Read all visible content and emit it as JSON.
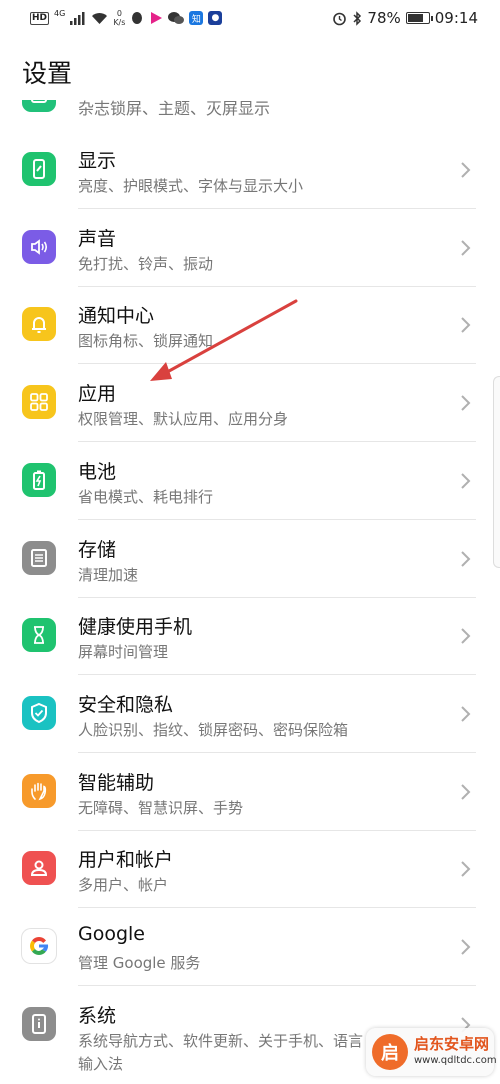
{
  "status_bar": {
    "network_badge": "HD",
    "network_type": "4G",
    "speed_value": "0",
    "speed_unit": "K/s",
    "zhihu_label": "知",
    "battery_percent": "78%",
    "battery_level": 0.78,
    "time": "09:14"
  },
  "header": {
    "title": "设置"
  },
  "partial_item": {
    "subtitle": "杂志锁屏、主题、灭屏显示",
    "icon": "theme-icon",
    "color": "#21c17a"
  },
  "items": [
    {
      "title": "显示",
      "subtitle": "亮度、护眼模式、字体与显示大小",
      "icon": "display-icon",
      "color": "#1fc36f"
    },
    {
      "title": "声音",
      "subtitle": "免打扰、铃声、振动",
      "icon": "sound-icon",
      "color": "#7b5ce6"
    },
    {
      "title": "通知中心",
      "subtitle": "图标角标、锁屏通知",
      "icon": "notification-bell-icon",
      "color": "#f7c51c"
    },
    {
      "title": "应用",
      "subtitle": "权限管理、默认应用、应用分身",
      "icon": "apps-grid-icon",
      "color": "#f7c51c"
    },
    {
      "title": "电池",
      "subtitle": "省电模式、耗电排行",
      "icon": "battery-icon",
      "color": "#1fc36f"
    },
    {
      "title": "存储",
      "subtitle": "清理加速",
      "icon": "storage-icon",
      "color": "#8d8d8d"
    },
    {
      "title": "健康使用手机",
      "subtitle": "屏幕时间管理",
      "icon": "hourglass-icon",
      "color": "#1fc36f"
    },
    {
      "title": "安全和隐私",
      "subtitle": "人脸识别、指纹、锁屏密码、密码保险箱",
      "icon": "shield-icon",
      "color": "#1ac2c2"
    },
    {
      "title": "智能辅助",
      "subtitle": "无障碍、智慧识屏、手势",
      "icon": "hand-icon",
      "color": "#f79a2b"
    },
    {
      "title": "用户和帐户",
      "subtitle": "多用户、帐户",
      "icon": "user-icon",
      "color": "#ef5151"
    },
    {
      "title": "Google",
      "subtitle": "管理 Google 服务",
      "icon": "google-icon",
      "color": "#ffffff"
    },
    {
      "title": "系统",
      "subtitle": "系统导航方式、软件更新、关于手机、语言",
      "subtitle2": "输入法",
      "icon": "phone-info-icon",
      "color": "#8d8d8d"
    }
  ],
  "watermark": {
    "title": "启东安卓网",
    "url": "www.qdltdc.com",
    "logo_glyph": "启"
  },
  "annotation": {
    "color": "#d9413e"
  }
}
